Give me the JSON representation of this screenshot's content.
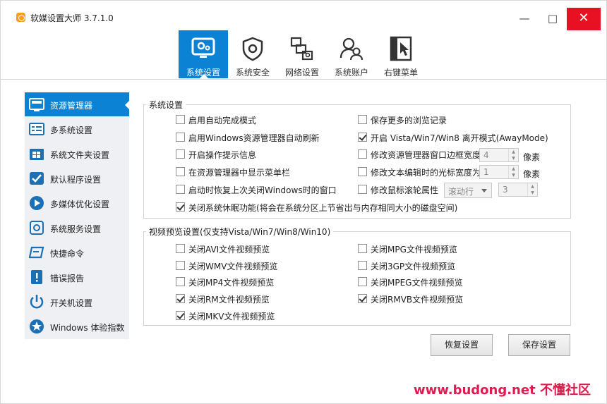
{
  "window": {
    "title": "软媒设置大师 3.7.1.0",
    "min_icon": "minimize-icon",
    "max_icon": "maximize-icon",
    "close_icon": "close-icon"
  },
  "toptabs": [
    {
      "label": "系统设置",
      "icon": "monitor-gear-icon",
      "active": true
    },
    {
      "label": "系统安全",
      "icon": "shield-icon",
      "active": false
    },
    {
      "label": "网络设置",
      "icon": "network-icon",
      "active": false
    },
    {
      "label": "系统账户",
      "icon": "users-icon",
      "active": false
    },
    {
      "label": "右键菜单",
      "icon": "cursor-menu-icon",
      "active": false
    }
  ],
  "sidebar": {
    "items": [
      {
        "label": "资源管理器",
        "icon": "explorer-icon",
        "active": true
      },
      {
        "label": "多系统设置",
        "icon": "multi-system-icon",
        "active": false
      },
      {
        "label": "系统文件夹设置",
        "icon": "windows-folder-icon",
        "active": false
      },
      {
        "label": "默认程序设置",
        "icon": "check-shield-icon",
        "active": false
      },
      {
        "label": "多媒体优化设置",
        "icon": "media-icon",
        "active": false
      },
      {
        "label": "系统服务设置",
        "icon": "service-icon",
        "active": false
      },
      {
        "label": "快捷命令",
        "icon": "shortcut-icon",
        "active": false
      },
      {
        "label": "错误报告",
        "icon": "error-report-icon",
        "active": false
      },
      {
        "label": "开关机设置",
        "icon": "power-icon",
        "active": false
      },
      {
        "label": "Windows 体验指数",
        "icon": "star-icon",
        "active": false
      }
    ]
  },
  "system_settings": {
    "title": "系统设置",
    "left_options": [
      {
        "label": "启用自动完成模式",
        "checked": false
      },
      {
        "label": "启用Windows资源管理器自动刷新",
        "checked": false
      },
      {
        "label": "开启操作提示信息",
        "checked": false
      },
      {
        "label": "在资源管理器中显示菜单栏",
        "checked": false
      },
      {
        "label": "启动时恢复上次关闭Windows时的窗口",
        "checked": false
      }
    ],
    "right_options": [
      {
        "label": "保存更多的浏览记录",
        "checked": false
      },
      {
        "label": "开启 Vista/Win7/Win8 离开模式(AwayMode)",
        "checked": true
      },
      {
        "label": "修改资源管理器窗口边框宽度",
        "checked": false
      },
      {
        "label": "修改文本编辑时的光标宽度为",
        "checked": false
      },
      {
        "label": "修改鼠标滚轮属性",
        "checked": false
      }
    ],
    "border_width_value": "4",
    "border_width_unit": "像素",
    "cursor_width_value": "1",
    "cursor_width_unit": "像素",
    "wheel_mode": "滚动行",
    "wheel_lines": "3",
    "hibernate_option": {
      "label": "关闭系统休眠功能(将会在系统分区上节省出与内存相同大小的磁盘空间)",
      "checked": true
    }
  },
  "video_preview": {
    "title": "视频预览设置(仅支持Vista/Win7/Win8/Win10)",
    "left_options": [
      {
        "label": "关闭AVI文件视频预览",
        "checked": false
      },
      {
        "label": "关闭WMV文件视频预览",
        "checked": false
      },
      {
        "label": "关闭MP4文件视频预览",
        "checked": false
      },
      {
        "label": "关闭RM文件视频预览",
        "checked": true
      },
      {
        "label": "关闭MKV文件视频预览",
        "checked": true
      }
    ],
    "right_options": [
      {
        "label": "关闭MPG文件视频预览",
        "checked": false
      },
      {
        "label": "关闭3GP文件视频预览",
        "checked": false
      },
      {
        "label": "关闭MPEG文件视频预览",
        "checked": false
      },
      {
        "label": "关闭RMVB文件视频预览",
        "checked": true
      }
    ]
  },
  "buttons": {
    "restore": "恢复设置",
    "save": "保存设置"
  },
  "watermark": "www.budong.net 不懂社区",
  "colors": {
    "accent": "#0b82d4",
    "close": "#e81123",
    "watermark": "#e0194f"
  }
}
